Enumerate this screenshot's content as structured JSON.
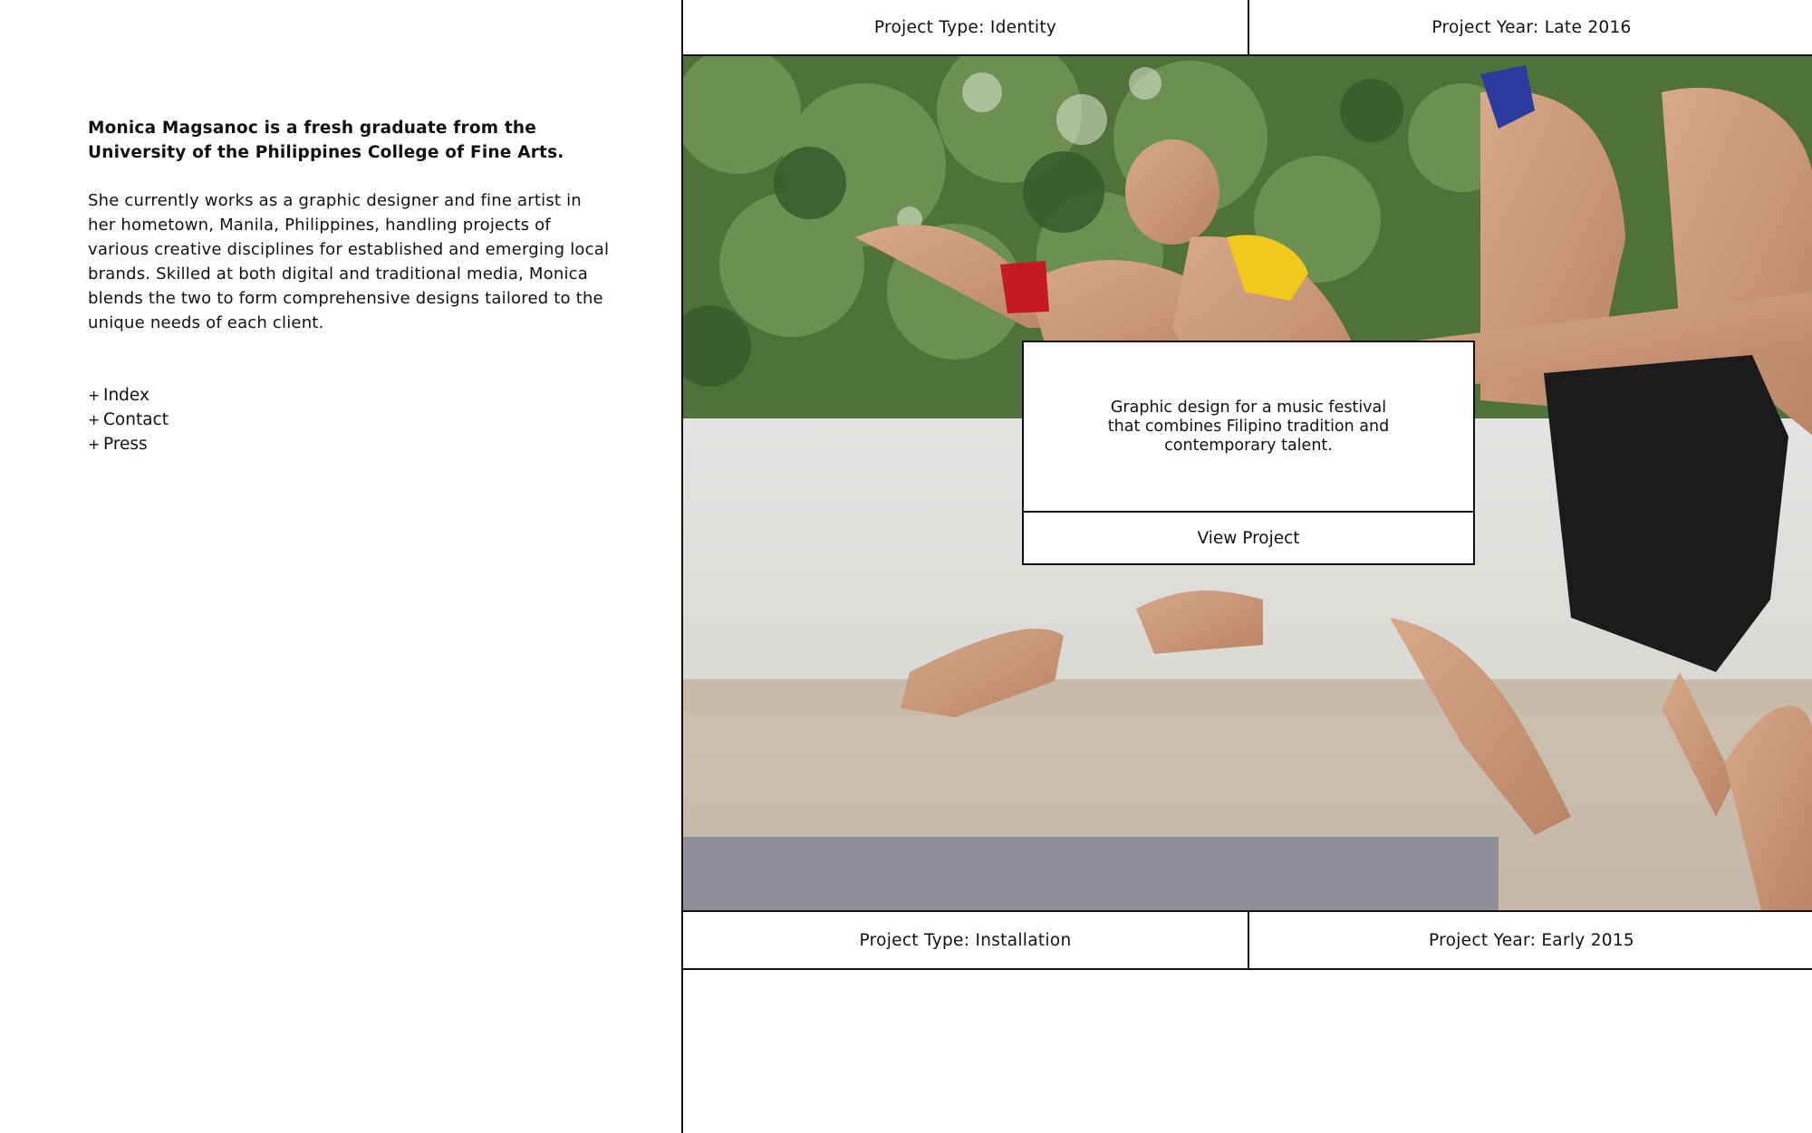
{
  "sidebar": {
    "bio_lead": "Monica Magsanoc is a fresh graduate from the University of the Philippines College of Fine Arts.",
    "bio_body": "She currently works as a graphic designer and fine artist in her hometown, Manila, Philippines, handling projects of various creative disciplines for established and emerging local brands. Skilled at both digital and traditional media, Monica blends the two to form comprehensive designs tailored to the unique needs of each client.",
    "nav": [
      {
        "prefix": "+",
        "label": "Index"
      },
      {
        "prefix": "+",
        "label": "Contact"
      },
      {
        "prefix": "+",
        "label": "Press"
      }
    ]
  },
  "projects": [
    {
      "type": "Project Type: Identity",
      "year": "Project Year: Late 2016",
      "description": "Graphic design for a music festival that combines Filipino tradition and contemporary talent.",
      "cta": "View Project"
    },
    {
      "type": "Project Type: Installation",
      "year": "Project Year: Early 2015"
    }
  ],
  "colors": {
    "text": "#111111",
    "background": "#ffffff",
    "rule": "#111111"
  }
}
